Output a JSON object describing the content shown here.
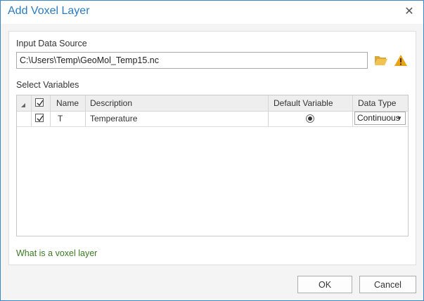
{
  "window": {
    "title": "Add Voxel Layer",
    "close_glyph": "✕"
  },
  "input": {
    "label": "Input Data Source",
    "value": "C:\\Users\\Temp\\GeoMol_Temp15.nc"
  },
  "icons": {
    "folder": "folder-open-icon",
    "warning": "warning-icon"
  },
  "variables": {
    "label": "Select Variables",
    "columns": {
      "name": "Name",
      "description": "Description",
      "default_variable": "Default Variable",
      "data_type": "Data Type"
    },
    "rows": [
      {
        "checked": true,
        "name": "T",
        "description": "Temperature",
        "default": true,
        "data_type": "Continuous"
      }
    ]
  },
  "help_link": "What is a voxel layer",
  "buttons": {
    "ok": "OK",
    "cancel": "Cancel"
  },
  "colors": {
    "accent": "#2b7bc0",
    "link": "#3c7a23",
    "warning": "#e8a317",
    "folder": "#f2c24f"
  }
}
